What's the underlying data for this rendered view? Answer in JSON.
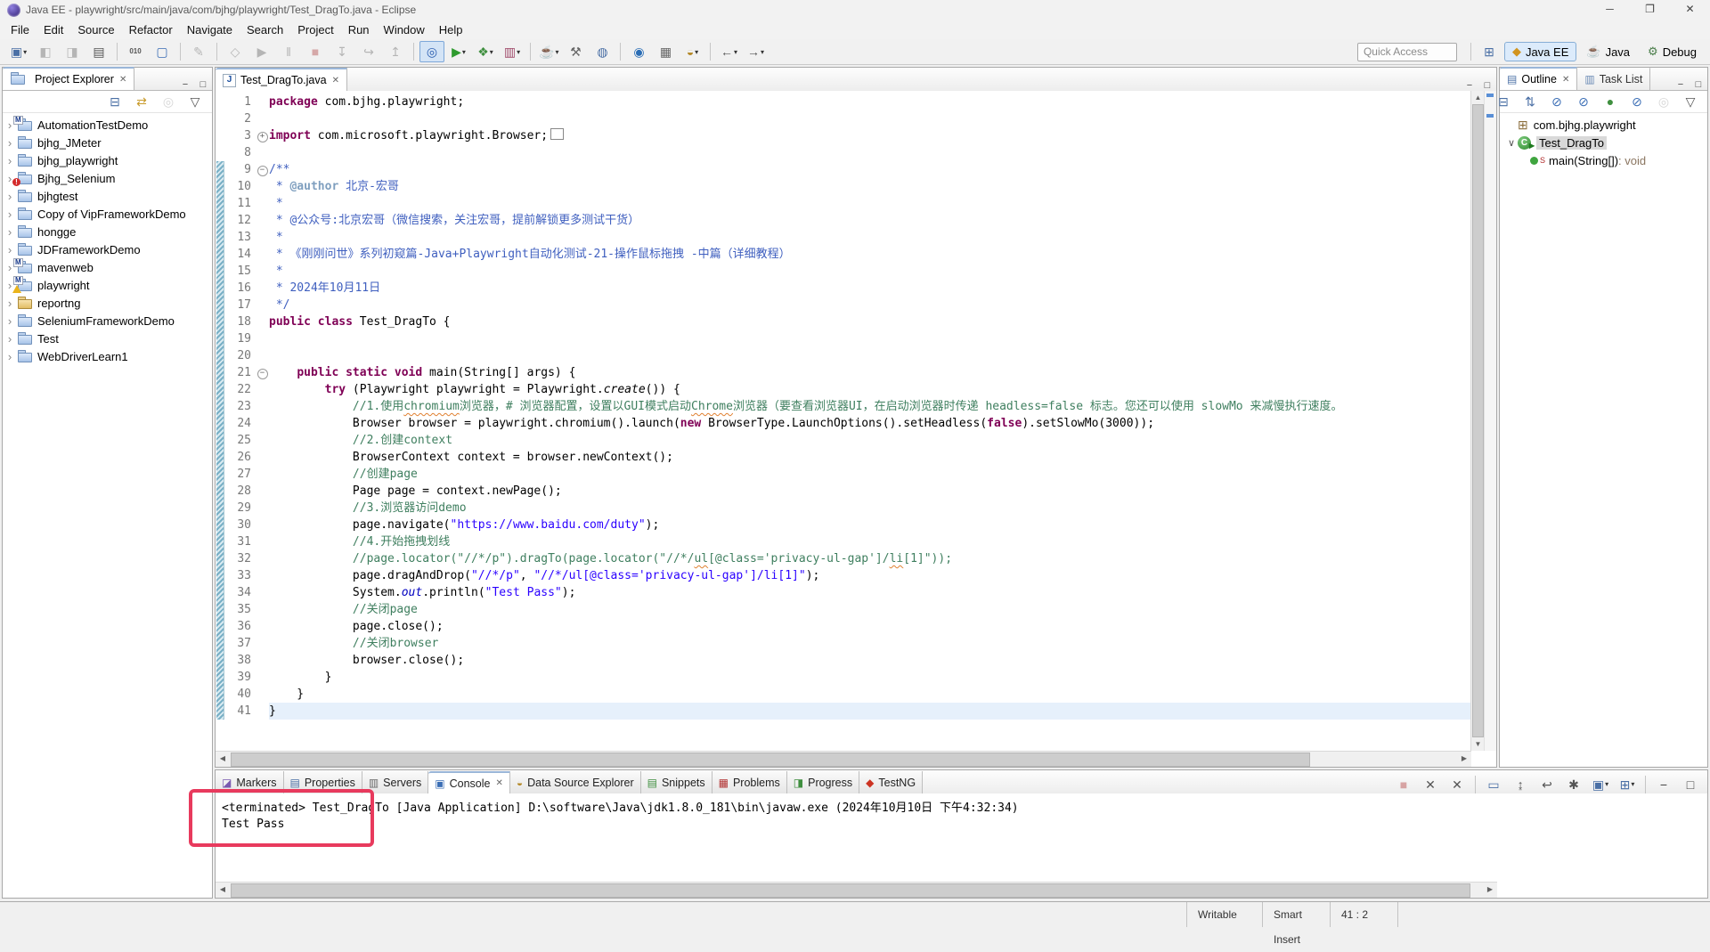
{
  "window": {
    "title": "Java EE - playwright/src/main/java/com/bjhg/playwright/Test_DragTo.java - Eclipse",
    "controls": [
      {
        "name": "minimize-button",
        "glyph": "─"
      },
      {
        "name": "maximize-button",
        "glyph": "❐"
      },
      {
        "name": "close-button",
        "glyph": "✕"
      }
    ]
  },
  "menu": [
    "File",
    "Edit",
    "Source",
    "Refactor",
    "Navigate",
    "Search",
    "Project",
    "Run",
    "Window",
    "Help"
  ],
  "toolbar": {
    "quick_access": "Quick Access",
    "buttons": [
      {
        "name": "new-wizard-button",
        "glyph": "▣",
        "color": "#4a6fa5",
        "dropdown": true
      },
      {
        "name": "save-button",
        "glyph": "◧",
        "color": "#555",
        "disabled": true
      },
      {
        "name": "save-all-button",
        "glyph": "◨",
        "color": "#555",
        "disabled": true
      },
      {
        "name": "print-button",
        "glyph": "▤",
        "color": "#555"
      },
      {
        "sep": true
      },
      {
        "name": "toggle-mark-occurrences-button",
        "glyph": "010",
        "color": "#555",
        "small": true
      },
      {
        "name": "new-web-component-button",
        "glyph": "▢",
        "color": "#3a6db5"
      },
      {
        "sep": true
      },
      {
        "name": "edit-annotation-button",
        "glyph": "✎",
        "color": "#555",
        "disabled": true
      },
      {
        "sep": true
      },
      {
        "name": "skip-breakpoints-button",
        "glyph": "◇",
        "color": "#555",
        "disabled": true
      },
      {
        "name": "resume-button",
        "glyph": "▶",
        "color": "#555",
        "disabled": true
      },
      {
        "name": "suspend-button",
        "glyph": "‖",
        "color": "#555",
        "disabled": true
      },
      {
        "name": "terminate-button",
        "glyph": "■",
        "color": "#aa3333",
        "disabled": true
      },
      {
        "name": "step-into-button",
        "glyph": "↧",
        "color": "#555",
        "disabled": true
      },
      {
        "name": "step-over-button",
        "glyph": "↪",
        "color": "#555",
        "disabled": true
      },
      {
        "name": "step-return-button",
        "glyph": "↥",
        "color": "#555",
        "disabled": true
      },
      {
        "sep": true
      },
      {
        "name": "search-button",
        "glyph": "◎",
        "color": "#2a5db0",
        "pressed": true
      },
      {
        "name": "run-button",
        "glyph": "▶",
        "color": "#2f9b2f",
        "dropdown": true
      },
      {
        "name": "debug-button",
        "glyph": "❖",
        "color": "#3f8f3f",
        "dropdown": true
      },
      {
        "name": "coverage-button",
        "glyph": "▥",
        "color": "#a04a6a",
        "dropdown": true
      },
      {
        "sep": true
      },
      {
        "name": "new-java-project-button",
        "glyph": "☕",
        "color": "#7a4a1f",
        "dropdown": true
      },
      {
        "name": "ant-button",
        "glyph": "⚒",
        "color": "#666"
      },
      {
        "name": "open-type-button",
        "glyph": "◍",
        "color": "#4a6fa5"
      },
      {
        "sep": true
      },
      {
        "name": "web-browser-button",
        "glyph": "◉",
        "color": "#2a6db5"
      },
      {
        "name": "servers-button",
        "glyph": "▦",
        "color": "#666"
      },
      {
        "name": "data-source-button",
        "glyph": "◒",
        "color": "#b58a2a",
        "dropdown": true
      },
      {
        "sep": true
      },
      {
        "name": "back-button",
        "glyph": "←",
        "color": "#555",
        "dropdown": true
      },
      {
        "name": "forward-button",
        "glyph": "→",
        "color": "#555",
        "dropdown": true
      }
    ],
    "perspectives": [
      {
        "name": "perspective-java-ee",
        "label": "Java EE",
        "glyph": "◆",
        "color": "#d1941f",
        "active": true
      },
      {
        "name": "perspective-java",
        "label": "Java",
        "glyph": "☕",
        "color": "#b5651d",
        "active": false
      },
      {
        "name": "perspective-debug",
        "label": "Debug",
        "glyph": "⚙",
        "color": "#4a7d4a",
        "active": false
      }
    ]
  },
  "project_explorer": {
    "title": "Project Explorer",
    "toolbar": [
      {
        "name": "collapse-all-icon",
        "glyph": "⊟",
        "color": "#4a6fa5"
      },
      {
        "name": "link-with-editor-icon",
        "glyph": "⇄",
        "color": "#c89a2a"
      },
      {
        "name": "focus-icon",
        "glyph": "◎",
        "color": "#999",
        "disabled": true
      },
      {
        "name": "view-menu-icon",
        "glyph": "▽",
        "color": "#555"
      }
    ],
    "items": [
      {
        "label": "AutomationTestDemo",
        "badges": [
          "maven"
        ]
      },
      {
        "label": "bjhg_JMeter",
        "badges": []
      },
      {
        "label": "bjhg_playwright",
        "badges": []
      },
      {
        "label": "Bjhg_Selenium",
        "badges": [
          "error"
        ]
      },
      {
        "label": "bjhgtest",
        "badges": []
      },
      {
        "label": "Copy of VipFrameworkDemo",
        "badges": []
      },
      {
        "label": "hongge",
        "badges": []
      },
      {
        "label": "JDFrameworkDemo",
        "badges": []
      },
      {
        "label": "mavenweb",
        "badges": [
          "maven"
        ]
      },
      {
        "label": "playwright",
        "badges": [
          "maven",
          "warning"
        ]
      },
      {
        "label": "reportng",
        "badges": [
          "closed"
        ]
      },
      {
        "label": "SeleniumFrameworkDemo",
        "badges": []
      },
      {
        "label": "Test",
        "badges": []
      },
      {
        "label": "WebDriverLearn1",
        "badges": []
      }
    ]
  },
  "editor": {
    "tab": "Test_DragTo.java",
    "lines": [
      {
        "n": "1",
        "tokens": [
          [
            "kw",
            "package"
          ],
          [
            "pl",
            " com.bjhg.playwright;"
          ]
        ]
      },
      {
        "n": "2",
        "tokens": []
      },
      {
        "n": "3",
        "fold": "+",
        "tokens": [
          [
            "kw",
            "import"
          ],
          [
            "pl",
            " com.microsoft.playwright.Browser;"
          ],
          [
            "box",
            ""
          ]
        ]
      },
      {
        "n": "8",
        "tokens": []
      },
      {
        "n": "9",
        "fold": "-",
        "tokens": [
          [
            "jd",
            "/**"
          ]
        ]
      },
      {
        "n": "10",
        "tokens": [
          [
            "jd",
            " * "
          ],
          [
            "jdt",
            "@author"
          ],
          [
            "jd",
            " 北京-宏哥"
          ]
        ]
      },
      {
        "n": "11",
        "tokens": [
          [
            "jd",
            " *"
          ]
        ]
      },
      {
        "n": "12",
        "tokens": [
          [
            "jd",
            " * @公众号:北京宏哥（微信搜索，关注宏哥，提前解锁更多测试干货）"
          ]
        ]
      },
      {
        "n": "13",
        "tokens": [
          [
            "jd",
            " *"
          ]
        ]
      },
      {
        "n": "14",
        "tokens": [
          [
            "jd",
            " * 《刚刚问世》系列初窥篇-Java+Playwright自动化测试-21-操作鼠标拖拽 -中篇（详细教程）"
          ]
        ]
      },
      {
        "n": "15",
        "tokens": [
          [
            "jd",
            " *"
          ]
        ]
      },
      {
        "n": "16",
        "tokens": [
          [
            "jd",
            " * 2024年10月11日"
          ]
        ]
      },
      {
        "n": "17",
        "tokens": [
          [
            "jd",
            " */"
          ]
        ]
      },
      {
        "n": "18",
        "tokens": [
          [
            "kw",
            "public"
          ],
          [
            "pl",
            " "
          ],
          [
            "kw",
            "class"
          ],
          [
            "pl",
            " Test_DragTo {"
          ]
        ]
      },
      {
        "n": "19",
        "tokens": []
      },
      {
        "n": "20",
        "tokens": []
      },
      {
        "n": "21",
        "fold": "-",
        "tokens": [
          [
            "pl",
            "    "
          ],
          [
            "kw",
            "public"
          ],
          [
            "pl",
            " "
          ],
          [
            "kw",
            "static"
          ],
          [
            "pl",
            " "
          ],
          [
            "kw",
            "void"
          ],
          [
            "pl",
            " main(String[] args) {"
          ]
        ]
      },
      {
        "n": "22",
        "tokens": [
          [
            "pl",
            "        "
          ],
          [
            "kw",
            "try"
          ],
          [
            "pl",
            " (Playwright playwright = Playwright."
          ],
          [
            "itpl",
            "create"
          ],
          [
            "pl",
            "()) {"
          ]
        ]
      },
      {
        "n": "23",
        "tokens": [
          [
            "pl",
            "            "
          ],
          [
            "cm",
            "//1.使用"
          ],
          [
            "cmsq",
            "chromium"
          ],
          [
            "cm",
            "浏览器，# 浏览器配置，设置以GUI模式启动"
          ],
          [
            "cmsq",
            "Chrome"
          ],
          [
            "cm",
            "浏览器（要查看浏览器UI，在启动浏览器时传递 headless=false 标志。您还可以使用 slowMo 来减慢执行速度。"
          ]
        ]
      },
      {
        "n": "24",
        "tokens": [
          [
            "pl",
            "            Browser browser = playwright.chromium().launch("
          ],
          [
            "kw",
            "new"
          ],
          [
            "pl",
            " BrowserType.LaunchOptions().setHeadless("
          ],
          [
            "kw",
            "false"
          ],
          [
            "pl",
            ").setSlowMo(3000));"
          ]
        ]
      },
      {
        "n": "25",
        "tokens": [
          [
            "pl",
            "            "
          ],
          [
            "cm",
            "//2.创建context"
          ]
        ]
      },
      {
        "n": "26",
        "tokens": [
          [
            "pl",
            "            BrowserContext context = browser.newContext();"
          ]
        ]
      },
      {
        "n": "27",
        "tokens": [
          [
            "pl",
            "            "
          ],
          [
            "cm",
            "//创建page"
          ]
        ]
      },
      {
        "n": "28",
        "tokens": [
          [
            "pl",
            "            Page page = context.newPage();"
          ]
        ]
      },
      {
        "n": "29",
        "tokens": [
          [
            "pl",
            "            "
          ],
          [
            "cm",
            "//3.浏览器访问demo"
          ]
        ]
      },
      {
        "n": "30",
        "tokens": [
          [
            "pl",
            "            page.navigate("
          ],
          [
            "str",
            "\"https://www.baidu.com/duty\""
          ],
          [
            "pl",
            ");"
          ]
        ]
      },
      {
        "n": "31",
        "tokens": [
          [
            "pl",
            "            "
          ],
          [
            "cm",
            "//4.开始拖拽划线"
          ]
        ]
      },
      {
        "n": "32",
        "tokens": [
          [
            "pl",
            "            "
          ],
          [
            "cm",
            "//page.locator(\"//*/p\").dragTo(page.locator(\"//*/"
          ],
          [
            "cmsq",
            "ul"
          ],
          [
            "cm",
            "[@class='privacy-ul-gap']/"
          ],
          [
            "cmsq",
            "li"
          ],
          [
            "cm",
            "[1]\"));"
          ]
        ]
      },
      {
        "n": "33",
        "tokens": [
          [
            "pl",
            "            page.dragAndDrop("
          ],
          [
            "str",
            "\"//*/p\""
          ],
          [
            "pl",
            ", "
          ],
          [
            "str",
            "\"//*/ul[@class='privacy-ul-gap']/li[1]\""
          ],
          [
            "pl",
            ");"
          ]
        ]
      },
      {
        "n": "34",
        "tokens": [
          [
            "pl",
            "            System."
          ],
          [
            "stf",
            "out"
          ],
          [
            "pl",
            ".println("
          ],
          [
            "str",
            "\"Test Pass\""
          ],
          [
            "pl",
            ");"
          ]
        ]
      },
      {
        "n": "35",
        "tokens": [
          [
            "pl",
            "            "
          ],
          [
            "cm",
            "//关闭page"
          ]
        ]
      },
      {
        "n": "36",
        "tokens": [
          [
            "pl",
            "            page.close();"
          ]
        ]
      },
      {
        "n": "37",
        "tokens": [
          [
            "pl",
            "            "
          ],
          [
            "cm",
            "//关闭browser"
          ]
        ]
      },
      {
        "n": "38",
        "tokens": [
          [
            "pl",
            "            browser.close();"
          ]
        ]
      },
      {
        "n": "39",
        "tokens": [
          [
            "pl",
            "        }"
          ]
        ]
      },
      {
        "n": "40",
        "tokens": [
          [
            "pl",
            "    }"
          ]
        ]
      },
      {
        "n": "41",
        "hl": true,
        "tokens": [
          [
            "pl",
            "}"
          ]
        ]
      }
    ]
  },
  "outline": {
    "tab_outline": "Outline",
    "tab_tasklist": "Task List",
    "toolbar": [
      {
        "name": "collapse-all-icon",
        "glyph": "⊟",
        "color": "#4a6fa5"
      },
      {
        "name": "sort-icon",
        "glyph": "⇅",
        "color": "#4a6fa5"
      },
      {
        "name": "hide-fields-icon",
        "glyph": "⊘",
        "color": "#3a6db5"
      },
      {
        "name": "hide-static-members-icon",
        "glyph": "⊘",
        "color": "#3a6db5"
      },
      {
        "name": "hide-non-public-icon",
        "glyph": "●",
        "color": "#3f8f3f"
      },
      {
        "name": "hide-local-types-icon",
        "glyph": "⊘",
        "color": "#3a6db5"
      },
      {
        "name": "focus-icon",
        "glyph": "◎",
        "color": "#999",
        "disabled": true
      },
      {
        "name": "view-menu-icon",
        "glyph": "▽",
        "color": "#555"
      }
    ],
    "package": "com.bjhg.playwright",
    "class_name": "Test_DragTo",
    "class_letter": "C",
    "method": "main(String[])",
    "method_return": " : void",
    "static_marker": "S"
  },
  "console": {
    "tabs": [
      {
        "label": "Markers",
        "glyph": "◪",
        "color": "#7a5ab0"
      },
      {
        "label": "Properties",
        "glyph": "▤",
        "color": "#4a6fa5"
      },
      {
        "label": "Servers",
        "glyph": "▥",
        "color": "#666"
      },
      {
        "label": "Console",
        "glyph": "▣",
        "color": "#3b6eb5",
        "active": true
      },
      {
        "label": "Data Source Explorer",
        "glyph": "◒",
        "color": "#b58a2a"
      },
      {
        "label": "Snippets",
        "glyph": "▤",
        "color": "#3f8f3f"
      },
      {
        "label": "Problems",
        "glyph": "▦",
        "color": "#b03030"
      },
      {
        "label": "Progress",
        "glyph": "◨",
        "color": "#3f8f3f"
      },
      {
        "label": "TestNG",
        "glyph": "◆",
        "color": "#cc3322"
      }
    ],
    "toolbar": [
      {
        "name": "terminate-icon",
        "glyph": "■",
        "color": "#b03030",
        "disabled": true
      },
      {
        "name": "remove-launch-icon",
        "glyph": "✕",
        "color": "#555"
      },
      {
        "name": "remove-all-launches-icon",
        "glyph": "✕",
        "color": "#555"
      },
      {
        "sep": true
      },
      {
        "name": "clear-console-icon",
        "glyph": "▭",
        "color": "#4a6fa5"
      },
      {
        "name": "scroll-lock-icon",
        "glyph": "↨",
        "color": "#555"
      },
      {
        "name": "word-wrap-icon",
        "glyph": "↩",
        "color": "#555"
      },
      {
        "name": "pin-console-icon",
        "glyph": "✱",
        "color": "#555"
      },
      {
        "name": "display-selected-console-icon",
        "glyph": "▣",
        "color": "#4a6fa5",
        "dropdown": true
      },
      {
        "name": "open-console-icon",
        "glyph": "⊞",
        "color": "#4a6fa5",
        "dropdown": true
      },
      {
        "sep": true
      },
      {
        "name": "minimize-icon",
        "glyph": "−",
        "color": "#444"
      },
      {
        "name": "maximize-icon",
        "glyph": "□",
        "color": "#444"
      }
    ],
    "header": "<terminated> Test_DragTo [Java Application] D:\\software\\Java\\jdk1.8.0_181\\bin\\javaw.exe (2024年10月10日 下午4:32:34)",
    "output": "Test Pass"
  },
  "statusbar": {
    "writable": "Writable",
    "insert_mode": "Smart Insert",
    "position": "41 : 2"
  },
  "colors": {
    "accent_tab": "#9ab6d8",
    "annotation_red": "#e83a5d",
    "keyword": "#7f0055",
    "string": "#2a00ff",
    "comment": "#3f7f5f",
    "javadoc": "#3f5fbf",
    "current_line": "#e6f0fb"
  }
}
